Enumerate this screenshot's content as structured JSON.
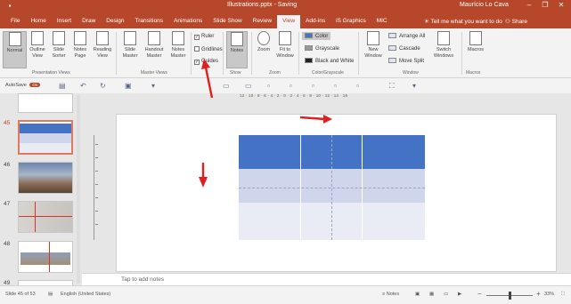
{
  "window": {
    "doc_title": "Illustrations.pptx - Saving",
    "user_name": "Maurício Lo Cava",
    "controls": [
      "–",
      "❐",
      "✕"
    ],
    "accent": "#b7472a"
  },
  "tabs": [
    {
      "label": "File",
      "active": false
    },
    {
      "label": "Home",
      "active": false
    },
    {
      "label": "Insert",
      "active": false
    },
    {
      "label": "Draw",
      "active": false
    },
    {
      "label": "Design",
      "active": false
    },
    {
      "label": "Transitions",
      "active": false
    },
    {
      "label": "Animations",
      "active": false
    },
    {
      "label": "Slide Show",
      "active": false
    },
    {
      "label": "Review",
      "active": false
    },
    {
      "label": "View",
      "active": true
    },
    {
      "label": "Add-ins",
      "active": false
    },
    {
      "label": "iS Graphics",
      "active": false
    },
    {
      "label": "MIC",
      "active": false
    }
  ],
  "tellme": "Tell me what you want to do",
  "share": "Share",
  "ribbon": {
    "presentation_views": {
      "label": "Presentation Views",
      "buttons": [
        "Normal",
        "Outline View",
        "Slide Sorter",
        "Notes Page",
        "Reading View"
      ]
    },
    "master_views": {
      "label": "Master Views",
      "buttons": [
        "Slide Master",
        "Handout Master",
        "Notes Master"
      ]
    },
    "show": {
      "label": "Show",
      "ruler": "Ruler",
      "gridlines": "Gridlines",
      "guides": "Guides",
      "ruler_checked": "✓",
      "gridlines_checked": "",
      "guides_checked": "✓"
    },
    "notes_button": "Notes",
    "zoom": {
      "label": "Zoom",
      "buttons": [
        "Zoom",
        "Fit to Window"
      ]
    },
    "color": {
      "label": "Color/Grayscale",
      "items": [
        "Color",
        "Grayscale",
        "Black and White"
      ]
    },
    "window": {
      "label": "Window",
      "new_window": "New Window",
      "items": [
        "Arrange All",
        "Cascade",
        "Move Split"
      ],
      "switch": "Switch Windows"
    },
    "macros": {
      "label": "Macros",
      "button": "Macros"
    }
  },
  "qat": {
    "autosave": "AutoSave",
    "toggle": "On"
  },
  "thumbnails": {
    "numbers": [
      "45",
      "46",
      "47",
      "48",
      "49"
    ],
    "selected": "45"
  },
  "ruler_text": "12 · 10 · 8 · 6 · 4 · 2 · 0 · 2 · 4 · 6 · 8 · 10 · 12 · 14 · 16",
  "table": {
    "colors": [
      "#4472c4",
      "#cfd5ea",
      "#e9ebf5"
    ]
  },
  "notes_placeholder": "Tap to add notes",
  "status": {
    "slide_info": "Slide 45 of 53",
    "language": "English (United States)",
    "notes": "Notes",
    "zoom_level": 0.5,
    "zoom_pct": "33%"
  }
}
